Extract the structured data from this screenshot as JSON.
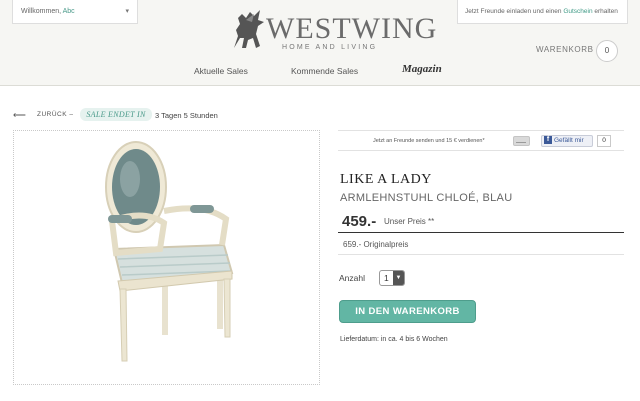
{
  "header": {
    "welcome_prefix": "Willkommen,",
    "welcome_user": "Abc",
    "invite_text": "Jetzt Freunde einladen und einen",
    "invite_link": "Gutschein",
    "invite_suffix": "erhalten",
    "logo_word": "WESTWING",
    "logo_sub": "HOME AND LIVING",
    "nav": [
      "Aktuelle Sales",
      "Kommende Sales",
      "Magazin"
    ],
    "cart_label": "WARENKORB",
    "cart_count": "0"
  },
  "breadcrumb": {
    "back": "ZURÜCK",
    "dash": "–",
    "sale_badge": "SALE ENDET IN",
    "sale_time": "3 Tagen 5 Stunden"
  },
  "share": {
    "text": "Jetzt an Freunde senden und 15 € verdienen*",
    "fb_like": "Gefällt mir",
    "fb_count": "0"
  },
  "product": {
    "title": "LIKE A LADY",
    "subtitle": "ARMLEHNSTUHL CHLOÉ, BLAU",
    "price": "459.-",
    "price_label": "Unser Preis **",
    "original": "659.- Originalpreis",
    "qty_label": "Anzahl",
    "qty_value": "1",
    "add_to_cart": "IN DEN WARENKORB",
    "delivery": "Lieferdatum: in ca. 4 bis 6 Wochen"
  },
  "colors": {
    "accent": "#62b6a4",
    "accent_text": "#4a9a8a",
    "header_bg": "#f6f6f3",
    "facebook": "#3b5998"
  },
  "icons": [
    "pegasus-logo-icon",
    "chevron-down-icon",
    "back-arrow-icon",
    "mail-icon",
    "facebook-icon"
  ]
}
